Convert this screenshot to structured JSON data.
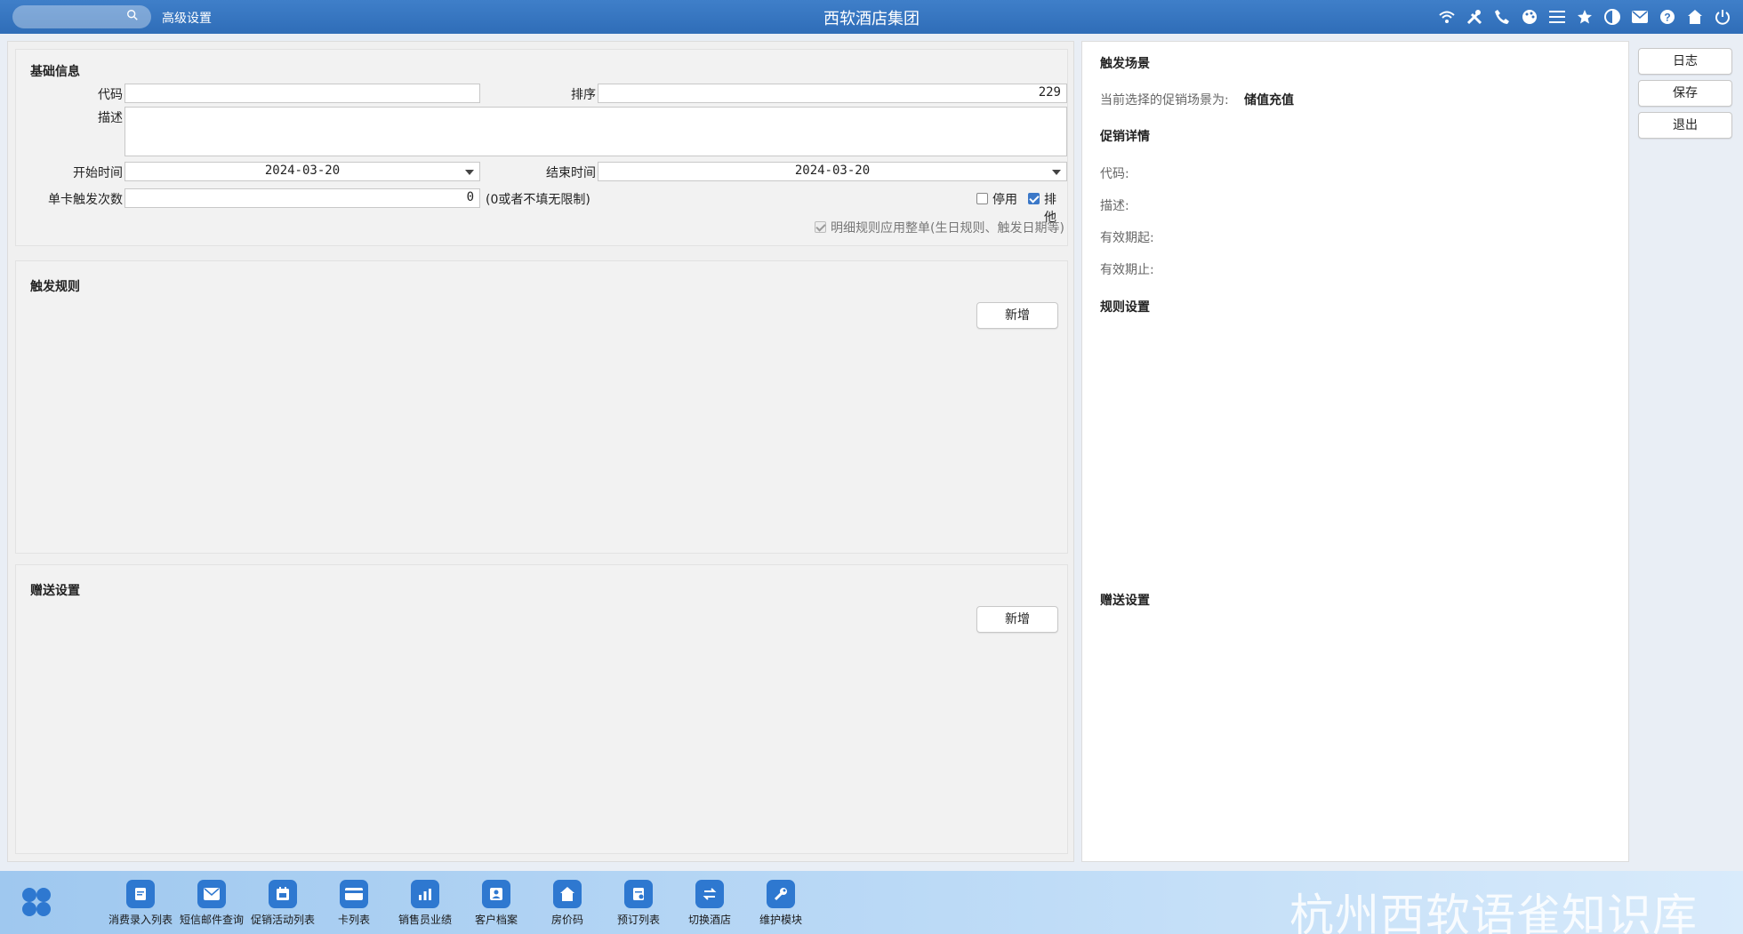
{
  "window": {
    "title": "西软酒店集团",
    "adv_settings": "高级设置"
  },
  "basic": {
    "section_title": "基础信息",
    "code_label": "代码",
    "code_value": "",
    "sort_label": "排序",
    "sort_value": "229",
    "desc_label": "描述",
    "desc_value": "",
    "start_label": "开始时间",
    "start_value": "2024-03-20",
    "end_label": "结束时间",
    "end_value": "2024-03-20",
    "count_label": "单卡触发次数",
    "count_value": "0",
    "count_hint": "(0或者不填无限制)",
    "disable_label": "停用",
    "disable_checked": false,
    "exclusive_label": "排他",
    "exclusive_checked": true,
    "detail_rule_label": "明细规则应用整单(生日规则、触发日期等)",
    "detail_rule_checked": true
  },
  "trigger_rules": {
    "section_title": "触发规则",
    "add_label": "新增"
  },
  "gift_settings": {
    "section_title": "赠送设置",
    "add_label": "新增"
  },
  "right": {
    "scene_title": "触发场景",
    "scene_prefix": "当前选择的促销场景为:",
    "scene_value": "储值充值",
    "promo_title": "促销详情",
    "code_label": "代码:",
    "desc_label": "描述:",
    "valid_from_label": "有效期起:",
    "valid_to_label": "有效期止:",
    "rule_title": "规则设置",
    "gift_title": "赠送设置"
  },
  "actions": {
    "log": "日志",
    "save": "保存",
    "exit": "退出"
  },
  "taskbar": {
    "items": [
      {
        "label": "消费录入列表",
        "icon": "edit-doc-icon"
      },
      {
        "label": "短信邮件查询",
        "icon": "mail-icon"
      },
      {
        "label": "促销活动列表",
        "icon": "calendar-icon"
      },
      {
        "label": "卡列表",
        "icon": "card-icon"
      },
      {
        "label": "销售员业绩",
        "icon": "chart-icon"
      },
      {
        "label": "客户档案",
        "icon": "profile-icon"
      },
      {
        "label": "房价码",
        "icon": "home-icon"
      },
      {
        "label": "预订列表",
        "icon": "booking-icon"
      },
      {
        "label": "切换酒店",
        "icon": "switch-icon"
      },
      {
        "label": "维护模块",
        "icon": "wrench-icon"
      }
    ],
    "watermark": "杭州西软语雀知识库"
  },
  "colors": {
    "topbar": "#3572bd",
    "accent": "#2e78d0",
    "panel_bg": "#f0f0f0"
  }
}
